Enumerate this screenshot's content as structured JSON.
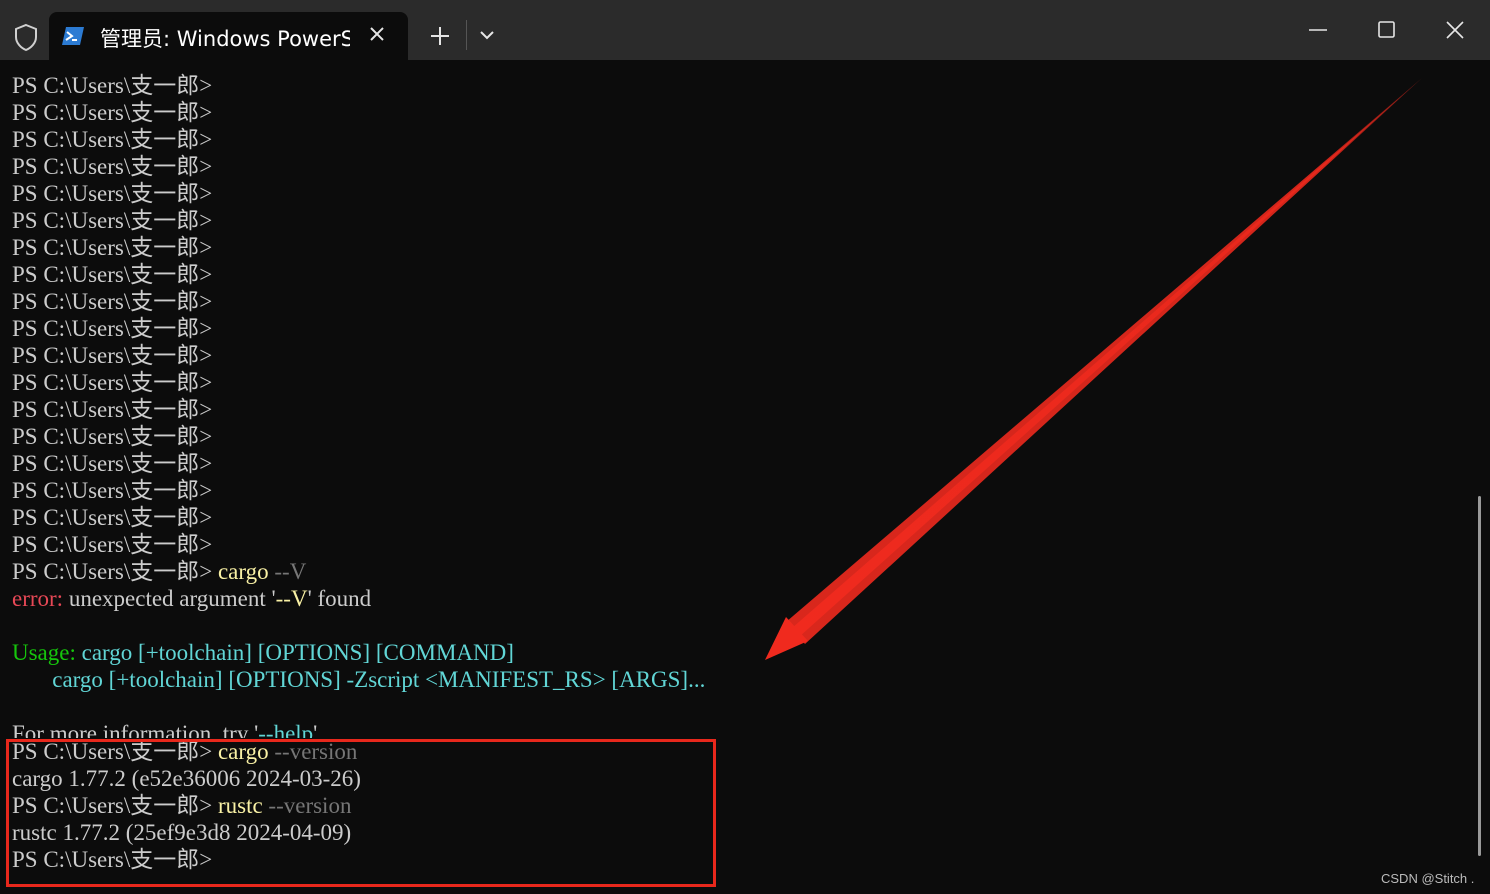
{
  "window": {
    "tab_title": "管理员: Windows PowerS",
    "icons": {
      "shield": "shield-icon",
      "tab": "powershell-icon",
      "close_tab": "close-icon",
      "new_tab": "plus-icon",
      "dropdown": "chevron-down-icon",
      "minimize": "minimize-icon",
      "maximize": "maximize-icon",
      "close_window": "close-icon"
    }
  },
  "terminal": {
    "prompt": "PS C:\\Users\\支一郎>",
    "empty_prompt_count": 18,
    "cargo_v_cmd": {
      "cmd": "cargo",
      "arg": "--V"
    },
    "error": {
      "label": "error:",
      "msg_a": "unexpected argument '",
      "arg": "--V",
      "msg_b": "' found"
    },
    "usage": {
      "label": "Usage:",
      "line1": {
        "cmd": "cargo",
        "toolchain": "[+toolchain]",
        "options": "[OPTIONS]",
        "command": "[COMMAND]"
      },
      "line2": {
        "cmd": "cargo",
        "toolchain": "[+toolchain]",
        "options": "[OPTIONS]",
        "zscript": "-Zscript",
        "manifest": "<MANIFEST_RS>",
        "args": "[ARGS]..."
      }
    },
    "help_line": {
      "text": "For more information, try '",
      "flag": "--help",
      "tail": "'."
    },
    "cargo_version_cmd": {
      "cmd": "cargo",
      "arg": "--version"
    },
    "cargo_version_out": "cargo 1.77.2 (e52e36006 2024-03-26)",
    "rustc_version_cmd": {
      "cmd": "rustc",
      "arg": "--version"
    },
    "rustc_version_out": "rustc 1.77.2 (25ef9e3d8 2024-04-09)"
  },
  "colors": {
    "background": "#0c0c0c",
    "titlebar": "#2b2b2b",
    "command": "#f9f1a5",
    "parameter": "#767676",
    "error": "#e74856",
    "usage_label": "#16c60c",
    "usage_text": "#61d6d6",
    "annotation": "#e8281c"
  },
  "watermark": "CSDN @Stitch ."
}
